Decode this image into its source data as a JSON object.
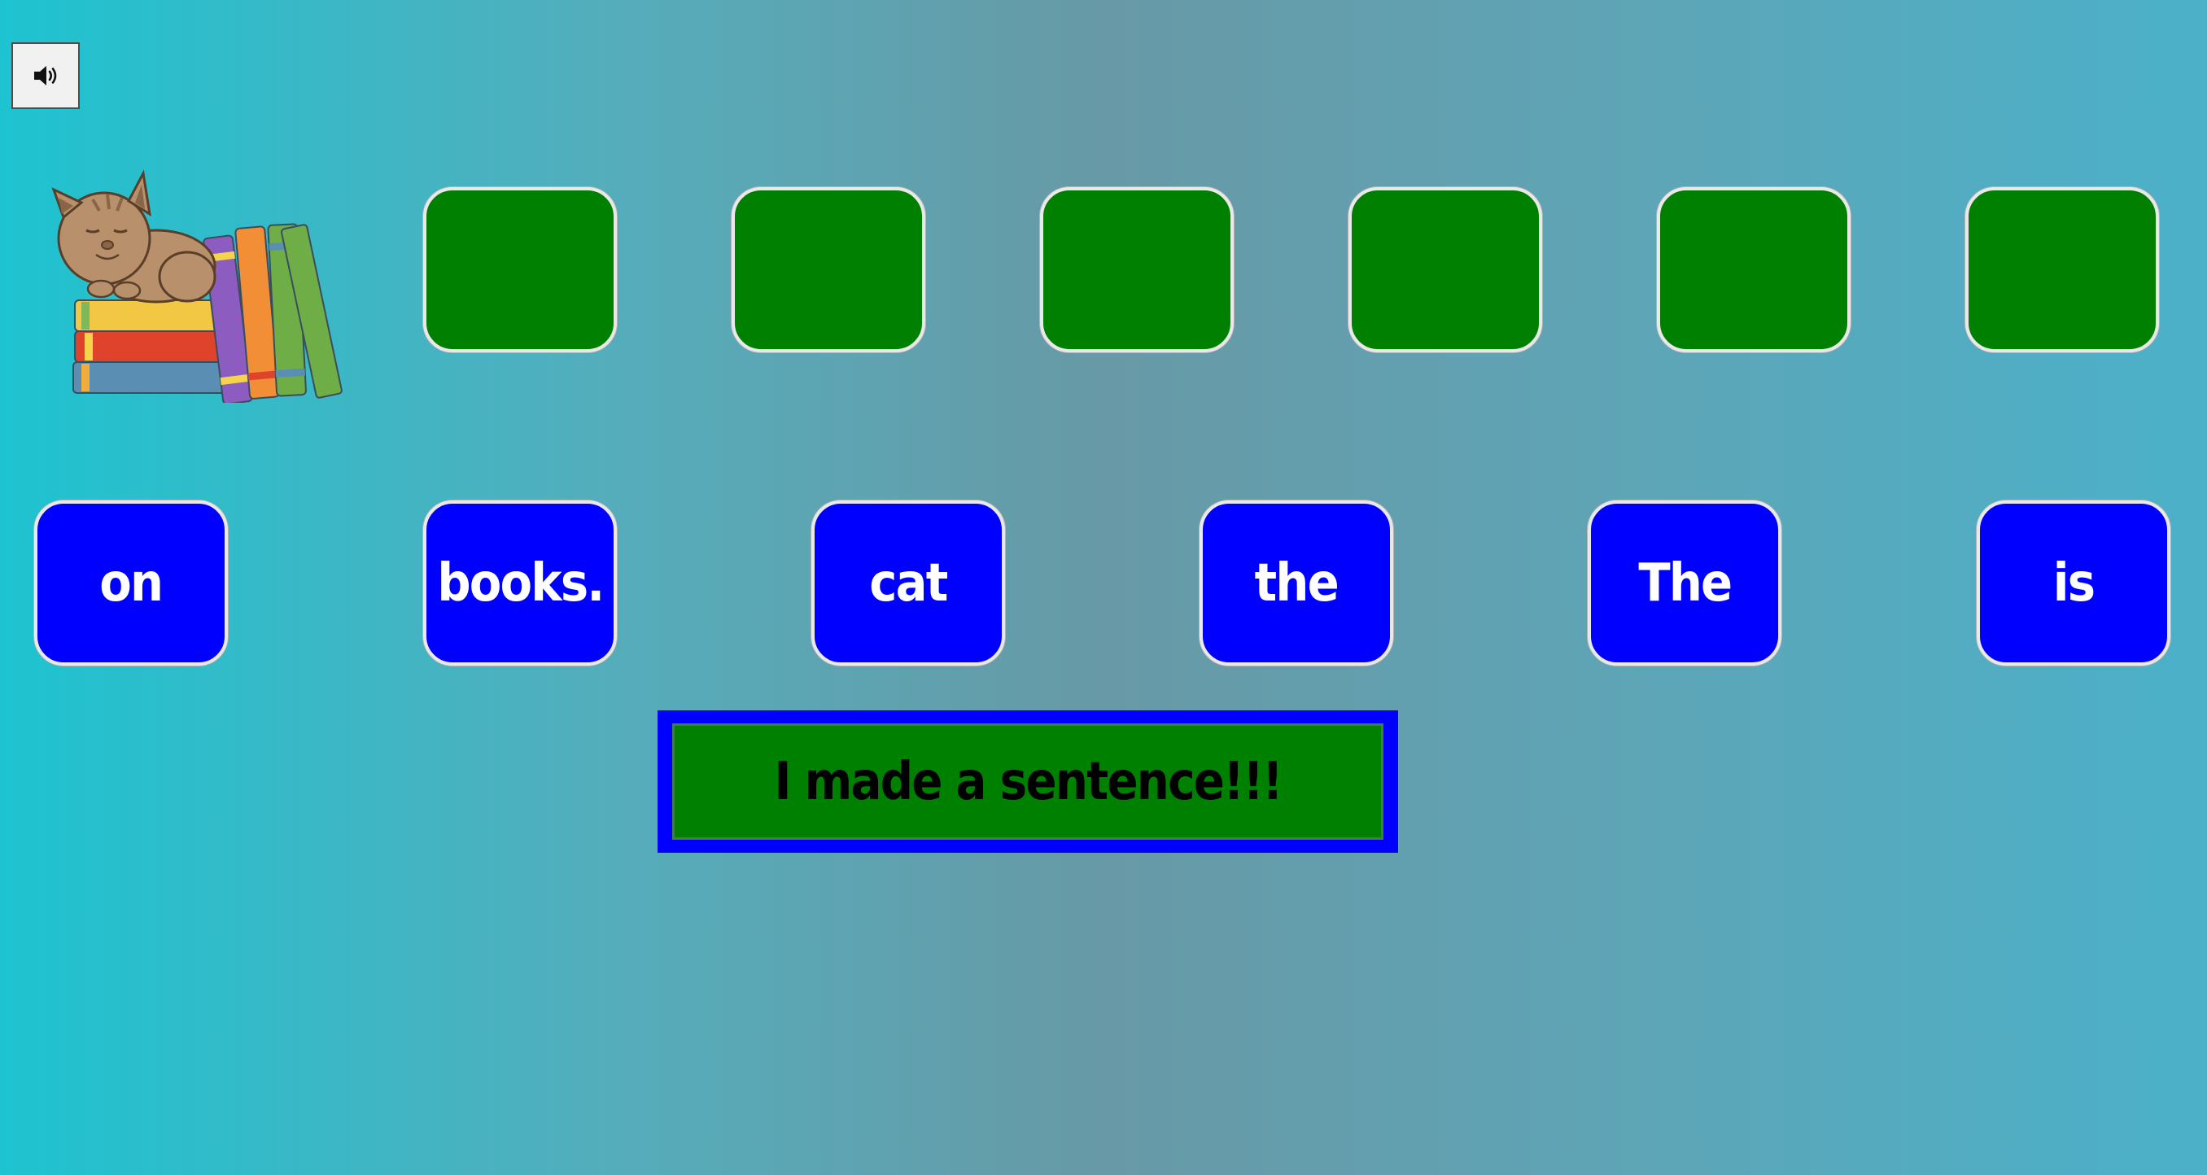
{
  "colors": {
    "slot": "#008000",
    "tile": "#0000ff",
    "tile_text": "#ffffff",
    "banner_border": "#0000ff",
    "banner_fill": "#008000",
    "banner_text": "#000000",
    "background_left": "#1ec3d1",
    "background_mid": "#6899a6",
    "background_right": "#4bb1c9"
  },
  "audio_button": {
    "icon": "speaker-icon"
  },
  "picture": {
    "icon": "cat-on-books-illustration"
  },
  "answer_slots": [
    "",
    "",
    "",
    "",
    "",
    ""
  ],
  "word_tiles": [
    "on",
    "books.",
    "cat",
    "the",
    "The",
    "is"
  ],
  "banner": {
    "text": "I made a sentence!!!"
  }
}
